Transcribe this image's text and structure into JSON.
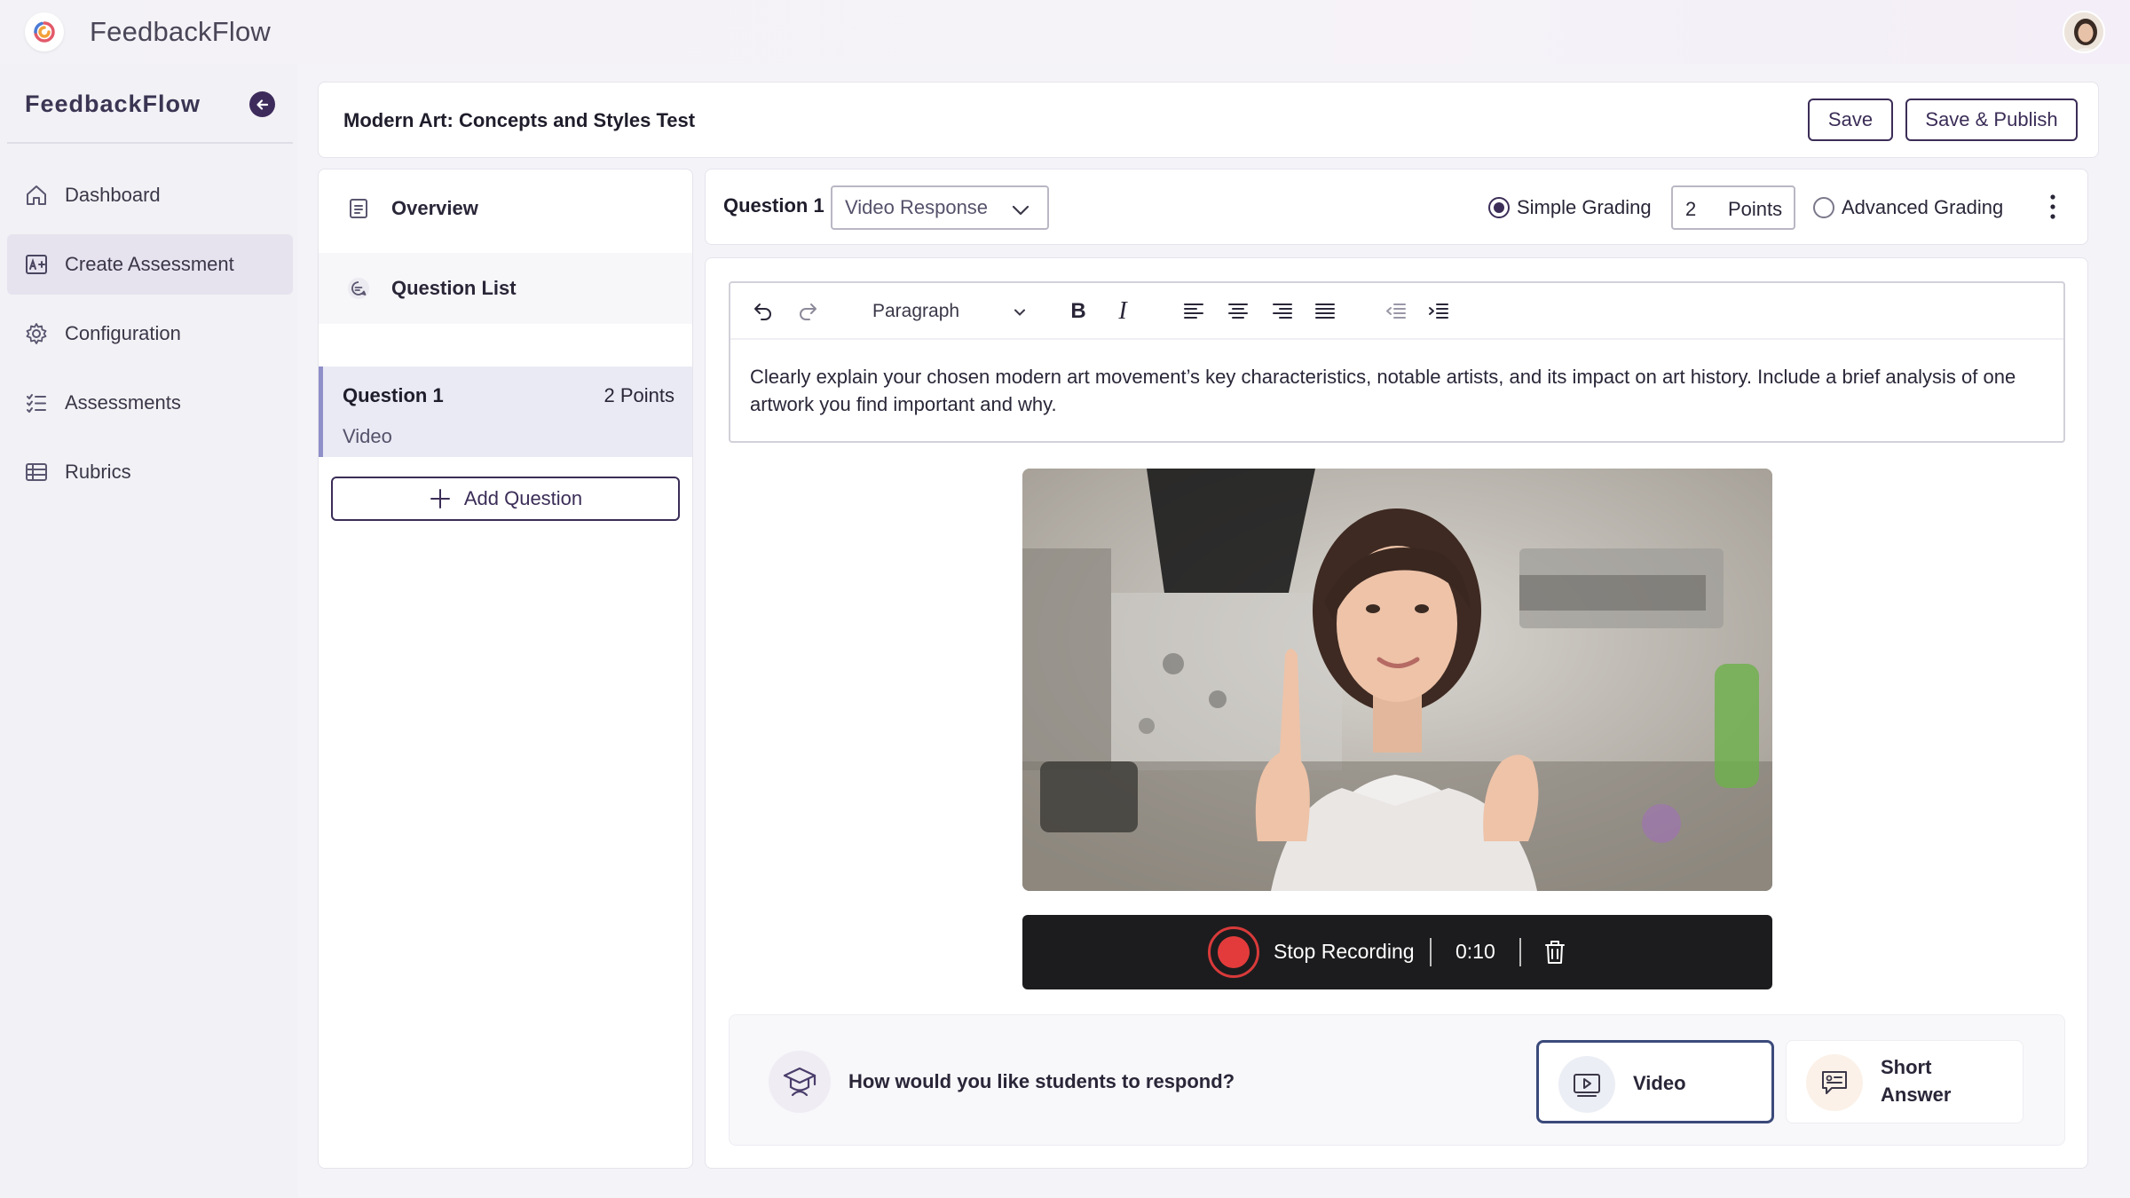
{
  "app": {
    "title": "FeedbackFlow"
  },
  "sidebar": {
    "brand": "FeedbackFlow",
    "items": [
      {
        "label": "Dashboard",
        "icon": "home-icon",
        "active": false
      },
      {
        "label": "Create Assessment",
        "icon": "create-assessment-icon",
        "active": true
      },
      {
        "label": "Configuration",
        "icon": "gear-icon",
        "active": false
      },
      {
        "label": "Assessments",
        "icon": "list-icon",
        "active": false
      },
      {
        "label": "Rubrics",
        "icon": "table-icon",
        "active": false
      }
    ]
  },
  "header": {
    "assessment_title": "Modern Art: Concepts and Styles Test",
    "save_label": "Save",
    "publish_label": "Save & Publish"
  },
  "question_panel": {
    "overview_label": "Overview",
    "question_list_label": "Question List",
    "question": {
      "name": "Question 1",
      "points": "2 Points",
      "type": "Video"
    },
    "add_question_label": "Add Question"
  },
  "question_bar": {
    "label": "Question 1",
    "response_type": "Video Response",
    "simple_grading_label": "Simple Grading",
    "points_value": "2",
    "points_unit": "Points",
    "advanced_grading_label": "Advanced Grading",
    "grading_mode": "simple"
  },
  "editor": {
    "block_format": "Paragraph",
    "text": "Clearly explain your chosen modern art movement’s key characteristics, notable artists, and its impact on art history. Include a brief analysis of one artwork you find important and why."
  },
  "recording": {
    "stop_label": "Stop Recording",
    "elapsed": "0:10"
  },
  "response": {
    "question": "How would you like students to respond?",
    "options": [
      {
        "label": "Video",
        "selected": true
      },
      {
        "label": "Short Answer",
        "selected": false
      }
    ]
  },
  "colors": {
    "accent": "#3b2d57",
    "record_red": "#e33b3b",
    "selected_row": "#e9eaf4"
  }
}
